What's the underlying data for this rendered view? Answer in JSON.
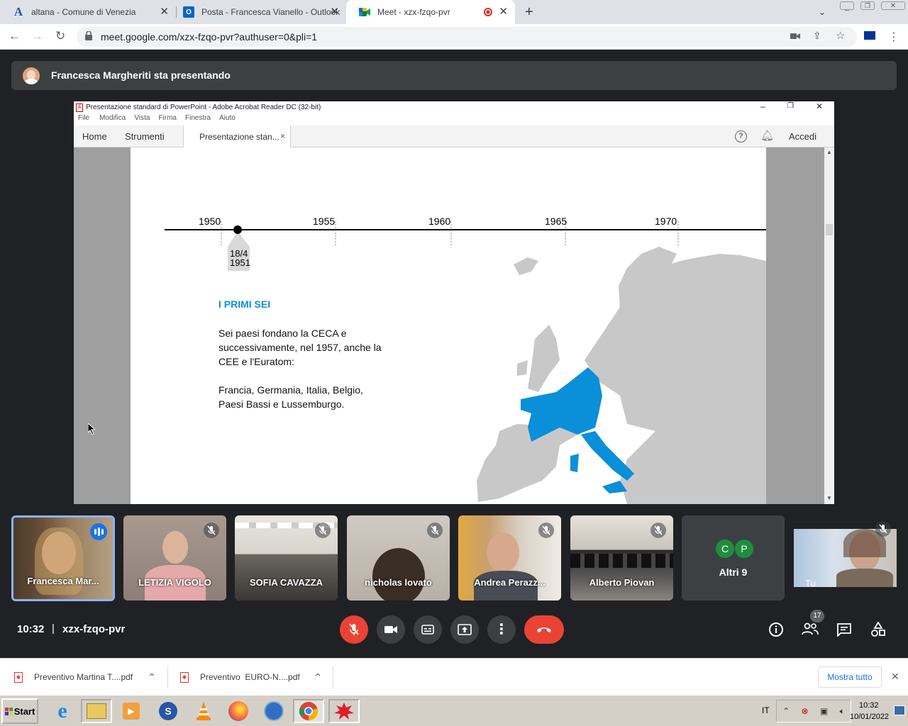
{
  "browser": {
    "tabs": [
      {
        "title": "altana - Comune di Venezia",
        "icon": "altana-logo-icon"
      },
      {
        "title": "Posta - Francesca Vianello - Outlook",
        "icon": "outlook-icon"
      },
      {
        "title": "Meet - xzx-fzqo-pvr",
        "icon": "google-meet-icon",
        "active": true
      }
    ],
    "new_tab_label": "+",
    "url": "meet.google.com/xzx-fzqo-pvr?authuser=0&pli=1"
  },
  "meet": {
    "presenter_text": "Francesca Margheriti sta presentando",
    "time": "10:32",
    "separator": "|",
    "meeting_code": "xzx-fzqo-pvr",
    "participants_count": "17",
    "participants": [
      {
        "name": "Francesca Mar...",
        "speaking": true
      },
      {
        "name": "LETIZIA VIGOLO",
        "muted": true
      },
      {
        "name": "SOFIA CAVAZZA",
        "muted": true
      },
      {
        "name": "nicholas lovato",
        "muted": true
      },
      {
        "name": "Andrea Perazz...",
        "muted": true
      },
      {
        "name": "Alberto Piovan",
        "muted": true
      }
    ],
    "others": {
      "label": "Altri 9",
      "avatars": [
        "C",
        "P"
      ]
    },
    "self_label": "Tu",
    "colors": {
      "end_call": "#ea4335",
      "mic_off": "#ea4335",
      "avatar_c": "#1e8e3e",
      "avatar_p": "#1e8e3e"
    }
  },
  "acrobat": {
    "title": "Presentazione standard di PowerPoint - Adobe Acrobat Reader DC (32-bit)",
    "menu": [
      "File",
      "Modifica",
      "Vista",
      "Firma",
      "Finestra",
      "Aiuto"
    ],
    "tabs": [
      "Home",
      "Strumenti"
    ],
    "doc_tab": "Presentazione stan...",
    "doc_tab_close": "×",
    "help_label": "?",
    "signin_label": "Accedi"
  },
  "slide": {
    "years": [
      "1950",
      "1955",
      "1960",
      "1965",
      "1970"
    ],
    "marker_date_line1": "18/4",
    "marker_date_line2": "1951",
    "heading": "I PRIMI SEI",
    "paragraph1_line1": "Sei paesi fondano la CECA e",
    "paragraph1_line2": "successivamente, nel 1957, anche la",
    "paragraph1_line3": "CEE e l'Euratom:",
    "paragraph2_line1": "Francia, Germania, Italia, Belgio,",
    "paragraph2_line2": "Paesi Bassi e Lussemburgo.",
    "heading_color": "#0f8fd6",
    "map_highlight_color": "#0a8fd9"
  },
  "downloads": {
    "items": [
      "Preventivo Martina T....pdf",
      "Preventivo  EURO-N....pdf"
    ],
    "show_all": "Mostra tutto",
    "close_label": "✕"
  },
  "taskbar": {
    "start": "Start",
    "lang": "IT",
    "time": "10:32",
    "date": "10/01/2022"
  }
}
